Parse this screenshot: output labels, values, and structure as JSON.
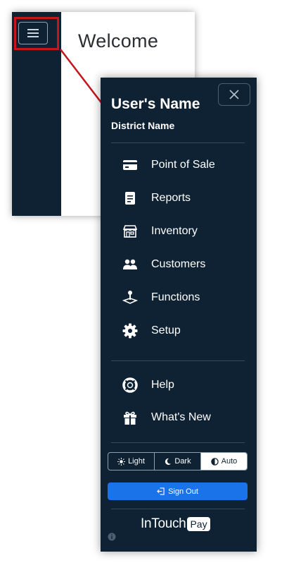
{
  "app": {
    "welcome_text": "Welcome"
  },
  "drawer": {
    "user_name": "User's Name",
    "district_name": "District Name",
    "nav_items": [
      {
        "label": "Point of Sale",
        "icon": "credit-card-icon"
      },
      {
        "label": "Reports",
        "icon": "document-icon"
      },
      {
        "label": "Inventory",
        "icon": "store-icon"
      },
      {
        "label": "Customers",
        "icon": "people-icon"
      },
      {
        "label": "Functions",
        "icon": "joystick-icon"
      },
      {
        "label": "Setup",
        "icon": "gear-icon"
      }
    ],
    "secondary_items": [
      {
        "label": "Help",
        "icon": "lifebuoy-icon"
      },
      {
        "label": "What's New",
        "icon": "gift-icon"
      }
    ],
    "theme": {
      "options": [
        "Light",
        "Dark",
        "Auto"
      ],
      "selected": "Auto"
    },
    "sign_out_label": "Sign Out",
    "logo": {
      "main": "InTouch",
      "badge": "Pay"
    }
  },
  "colors": {
    "sidebar_bg": "#0e2233",
    "highlight": "#c4161c",
    "accent": "#1a73e8"
  }
}
